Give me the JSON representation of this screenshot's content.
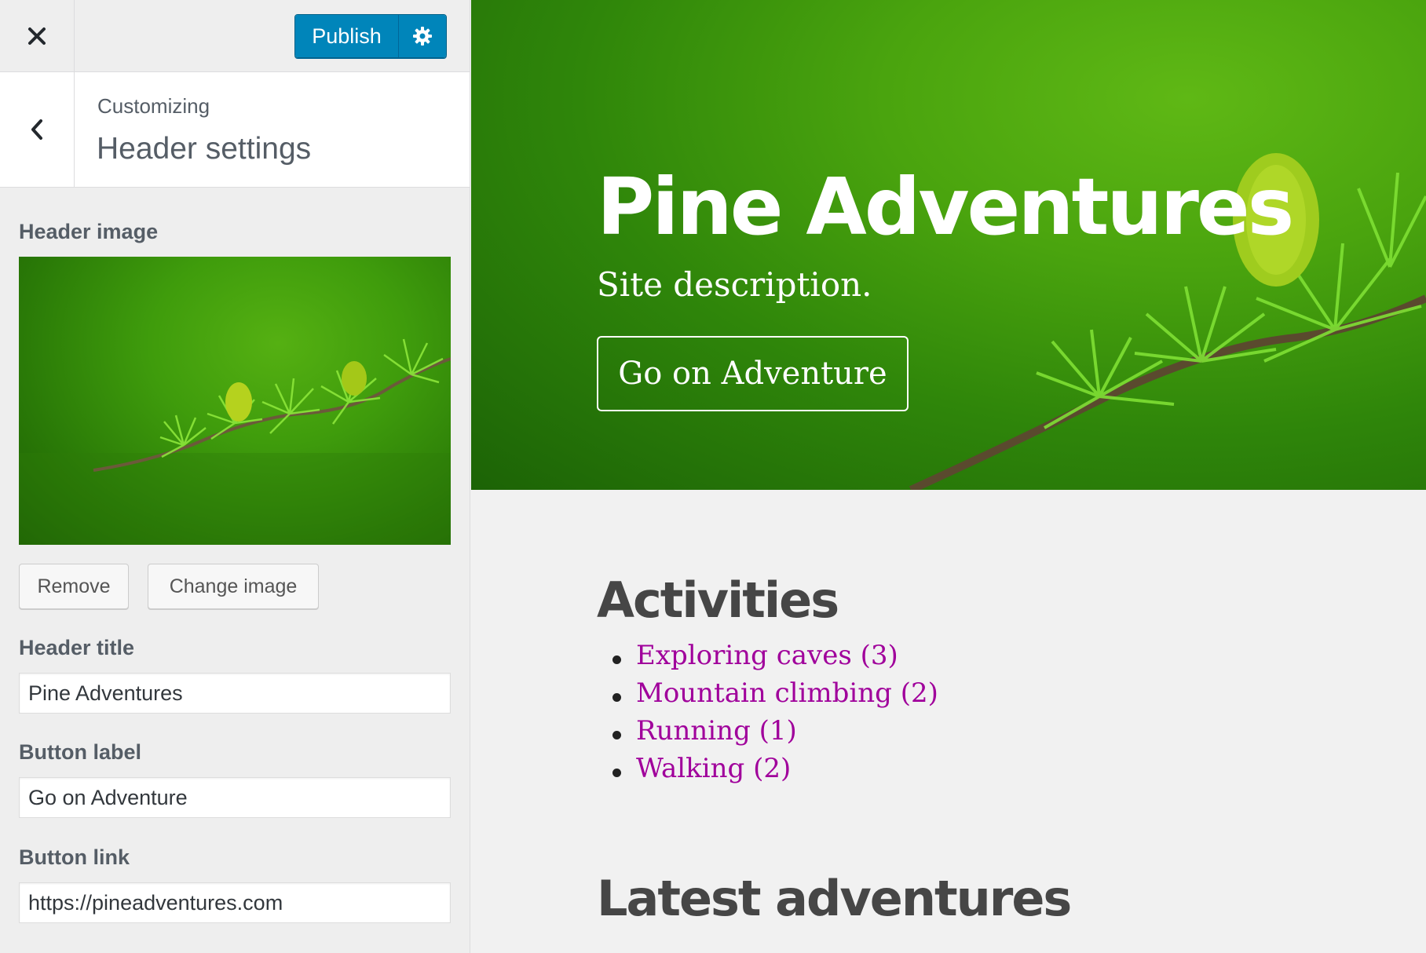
{
  "topbar": {
    "close_icon": "close-icon",
    "publish_label": "Publish",
    "settings_icon": "gear-icon",
    "accent": "#0085ba"
  },
  "section": {
    "breadcrumb": "Customizing",
    "title": "Header settings",
    "back_icon": "chevron-left-icon"
  },
  "controls": {
    "header_image_label": "Header image",
    "remove_label": "Remove",
    "change_image_label": "Change image",
    "header_title_label": "Header title",
    "header_title_value": "Pine Adventures",
    "button_label_label": "Button label",
    "button_label_value": "Go on Adventure",
    "button_link_label": "Button link",
    "button_link_value": "https://pineadventures.com"
  },
  "preview": {
    "site_title": "Pine Adventures",
    "site_description": "Site description.",
    "cta_label": "Go on Adventure",
    "activities_heading": "Activities",
    "activities": [
      "Exploring caves (3)",
      "Mountain climbing (2)",
      "Running (1)",
      "Walking (2)"
    ],
    "latest_heading": "Latest adventures",
    "link_color": "#a0009b"
  }
}
